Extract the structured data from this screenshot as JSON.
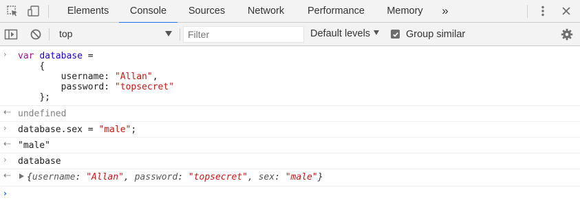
{
  "tabbar": {
    "icons": [
      "inspect-element-icon",
      "device-toolbar-icon"
    ],
    "tabs": [
      "Elements",
      "Console",
      "Sources",
      "Network",
      "Performance",
      "Memory"
    ],
    "active_tab": "Console",
    "more_tabs": "»",
    "menu_icon": "kebab-menu-icon",
    "close_icon": "close-icon"
  },
  "toolbar": {
    "context": "top",
    "filter_placeholder": "Filter",
    "levels_label": "Default levels",
    "group_similar_label": "Group similar",
    "group_similar_checked": true
  },
  "console": {
    "entry1": {
      "keyword": "var",
      "name": "database",
      "op": " =",
      "open": "{",
      "k1": "username: ",
      "v1": "\"Allan\"",
      "c1": ",",
      "k2": "password: ",
      "v2": "\"topsecret\"",
      "close": "};"
    },
    "result1": "undefined",
    "entry2": {
      "code": "database.sex = ",
      "value": "\"male\"",
      "end": ";"
    },
    "result2": "\"male\"",
    "entry3": "database",
    "result3": {
      "open": "{",
      "k1": "username",
      "v1": "\"Allan\"",
      "k2": "password",
      "v2": "\"topsecret\"",
      "k3": "sex",
      "v3": "\"male\"",
      "close": "}"
    }
  },
  "colors": {
    "accent": "#1a73e8",
    "keyword": "#aa0d91",
    "variable": "#1c00cf",
    "string": "#c41a16"
  }
}
